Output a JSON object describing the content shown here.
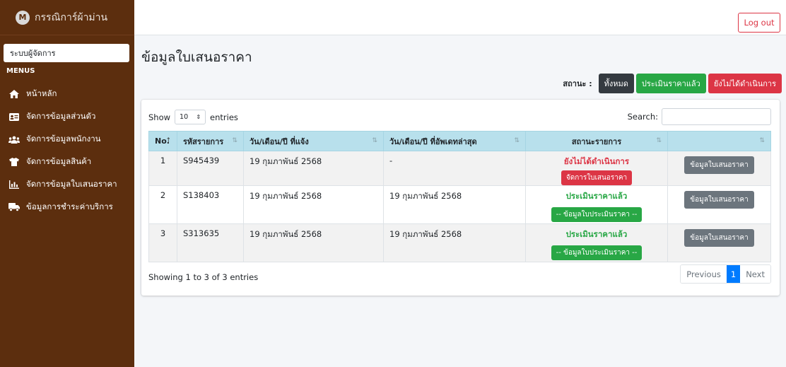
{
  "brand": {
    "logo_letter": "M",
    "name": "กรรณิการ์ผ้าม่าน"
  },
  "sidebar": {
    "admin_label": "ระบบผู้จัดการ",
    "menus_heading": "MENUS",
    "items": [
      {
        "label": "หน้าหลัก",
        "icon": "home-icon"
      },
      {
        "label": "จัดการข้อมูลส่วนตัว",
        "icon": "id-card-icon"
      },
      {
        "label": "จัดการข้อมูลพนักงาน",
        "icon": "users-icon"
      },
      {
        "label": "จัดการข้อมูลสินค้า",
        "icon": "shirt-icon"
      },
      {
        "label": "จัดการข้อมูลใบเสนอราคา",
        "icon": "chart-icon"
      },
      {
        "label": "ข้อมูลการชำระค่าบริการ",
        "icon": "truck-icon"
      }
    ]
  },
  "topbar": {
    "logout_label": "Log out"
  },
  "page": {
    "title": "ข้อมูลใบเสนอราคา"
  },
  "status_filter": {
    "label": "สถานะ :",
    "buttons": [
      {
        "label": "ทั้งหมด",
        "color": "#343a40"
      },
      {
        "label": "ประเมินราคาแล้ว",
        "color": "#28a745"
      },
      {
        "label": "ยังไม่ได้ดำเนินการ",
        "color": "#dc3545"
      }
    ]
  },
  "table_controls": {
    "show_label": "Show",
    "page_length": "10",
    "entries_label": "entries",
    "search_label": "Search:",
    "search_value": ""
  },
  "table": {
    "columns": [
      "No.",
      "รหัสรายการ",
      "วัน/เดือน/ปี ที่แจ้ง",
      "วัน/เดือน/ปี ที่อัพเดทล่าสุด",
      "สถานะรายการ",
      ""
    ],
    "rows": [
      {
        "no": "1",
        "code": "S945439",
        "reported": "19 กุมภาพันธ์ 2568",
        "updated": "-",
        "status": "ยังไม่ได้ดำเนินการ",
        "status_color": "#dc3545",
        "status_action": "จัดการใบเสนอราคา",
        "action": "ข้อมูลใบเสนอราคา"
      },
      {
        "no": "2",
        "code": "S138403",
        "reported": "19 กุมภาพันธ์ 2568",
        "updated": "19 กุมภาพันธ์ 2568",
        "status": "ประเมินราคาแล้ว",
        "status_color": "#28a745",
        "status_action": "-- ข้อมูลใบประเมินราคา --",
        "action": "ข้อมูลใบเสนอราคา"
      },
      {
        "no": "3",
        "code": "S313635",
        "reported": "19 กุมภาพันธ์ 2568",
        "updated": "19 กุมภาพันธ์ 2568",
        "status": "ประเมินราคาแล้ว",
        "status_color": "#28a745",
        "status_action": "-- ข้อมูลใบประเมินราคา --",
        "action": "ข้อมูลใบเสนอราคา"
      }
    ]
  },
  "footer": {
    "info": "Showing 1 to 3 of 3 entries",
    "previous": "Previous",
    "current_page": "1",
    "next": "Next"
  }
}
